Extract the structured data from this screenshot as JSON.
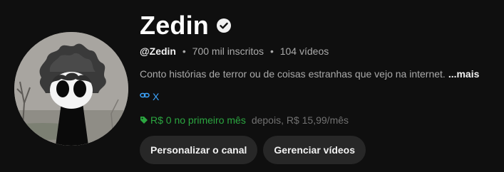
{
  "channel": {
    "name": "Zedin",
    "verified_icon": "verified-check-icon",
    "handle": "@Zedin",
    "subscribers": "700 mil inscritos",
    "videos": "104 vídeos",
    "separator": "•",
    "description": "Conto histórias de terror ou de coisas estranhas que vejo na internet.",
    "more_label": "...mais",
    "link_icon": "link-icon",
    "link_label": "X"
  },
  "membership": {
    "tag_icon": "tag-icon",
    "promo": "R$ 0 no primeiro mês",
    "after": "depois, R$ 15,99/mês",
    "promo_color": "#2ba640"
  },
  "buttons": {
    "customize": "Personalizar o canal",
    "manage": "Gerenciar vídeos"
  },
  "colors": {
    "background": "#0f0f0f",
    "link": "#3ea6ff",
    "button_bg": "#272727"
  }
}
